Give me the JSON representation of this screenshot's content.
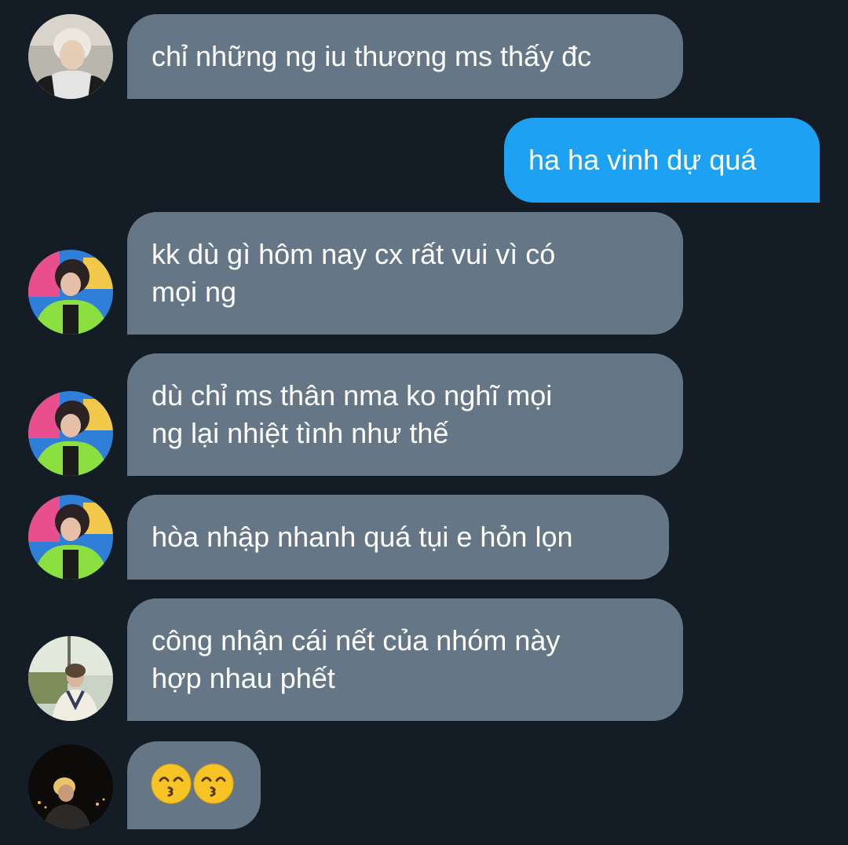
{
  "messages": [
    {
      "id": 1,
      "direction": "received",
      "avatar": "avatar-white-hair-hoodie",
      "lines": [
        "chỉ những ng iu thương ms thấy đc"
      ]
    },
    {
      "id": 2,
      "direction": "sent",
      "lines": [
        "ha ha vinh dự quá"
      ]
    },
    {
      "id": 3,
      "direction": "received",
      "avatar": "avatar-green-jacket",
      "lines": [
        "kk dù gì hôm nay cx rất vui vì có",
        "mọi ng"
      ]
    },
    {
      "id": 4,
      "direction": "received",
      "avatar": "avatar-green-jacket",
      "lines": [
        "dù chỉ ms thân nma ko nghĩ mọi",
        "ng lại nhiệt tình như thế"
      ]
    },
    {
      "id": 5,
      "direction": "received",
      "avatar": "avatar-green-jacket",
      "lines": [
        "hòa nhập nhanh quá tụi e hỏn lọn"
      ]
    },
    {
      "id": 6,
      "direction": "received",
      "avatar": "avatar-outdoor-sweater",
      "lines": [
        "công nhận cái nết của nhóm này",
        "hợp nhau phết"
      ]
    },
    {
      "id": 7,
      "direction": "received",
      "avatar": "avatar-night-blonde",
      "emojis": [
        "kissing-face-with-smiling-eyes",
        "kissing-face-with-smiling-eyes"
      ]
    }
  ],
  "colors": {
    "background": "#141d26",
    "received_bubble": "#657786",
    "sent_bubble": "#1da1f2",
    "text": "#ffffff"
  }
}
